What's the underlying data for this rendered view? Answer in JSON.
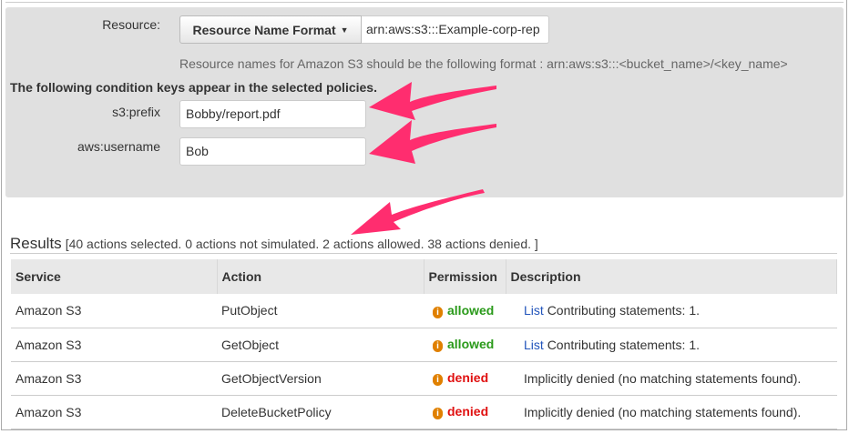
{
  "resource": {
    "label": "Resource:",
    "format_button": "Resource Name Format",
    "arn_value": "arn:aws:s3:::Example-corp-rep",
    "hint": "Resource names for Amazon S3 should be the following format : arn:aws:s3:::<bucket_name>/<key_name>"
  },
  "conditions": {
    "heading": "The following condition keys appear in the selected policies.",
    "keys": [
      {
        "label": "s3:prefix",
        "value": "Bobby/report.pdf"
      },
      {
        "label": "aws:username",
        "value": "Bob"
      }
    ]
  },
  "results": {
    "title": "Results",
    "summary": "[40 actions selected. 0 actions not simulated. 2 actions allowed. 38 actions denied. ]",
    "columns": [
      "Service",
      "Action",
      "Permission",
      "Description"
    ],
    "rows": [
      {
        "service": "Amazon S3",
        "action": "PutObject",
        "permission": "allowed",
        "link": "List",
        "description": "Contributing statements: 1."
      },
      {
        "service": "Amazon S3",
        "action": "GetObject",
        "permission": "allowed",
        "link": "List",
        "description": "Contributing statements: 1."
      },
      {
        "service": "Amazon S3",
        "action": "GetObjectVersion",
        "permission": "denied",
        "description": "Implicitly denied (no matching statements found)."
      },
      {
        "service": "Amazon S3",
        "action": "DeleteBucketPolicy",
        "permission": "denied",
        "description": "Implicitly denied (no matching statements found)."
      }
    ]
  },
  "colors": {
    "allowed": "#2a9a1a",
    "denied": "#e01010",
    "arrow": "#ff2d6f",
    "info": "#e08000"
  }
}
